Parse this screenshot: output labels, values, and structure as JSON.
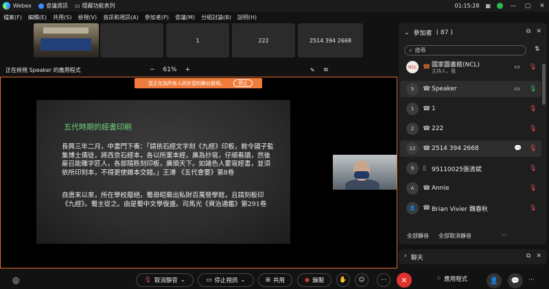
{
  "titlebar": {
    "app_name": "Webex",
    "meeting_info": "會議資訊",
    "hidden_features": "隱藏功能表列",
    "time": "01:15:28",
    "minimize": "—",
    "maximize": "▢",
    "close": "✕"
  },
  "menu": [
    "檔案(F)",
    "編輯(E)",
    "共用(S)",
    "檢視(V)",
    "音訊和視訊(A)",
    "參加者(P)",
    "會議(M)",
    "分組討論(B)",
    "說明(H)"
  ],
  "thumbnails": [
    {
      "label": ""
    },
    {
      "label": ""
    },
    {
      "label": "1"
    },
    {
      "label": "222"
    },
    {
      "label": "2514 394 2668"
    }
  ],
  "sharebar": {
    "viewing_text": "正在檢視 Speaker 的應用程式",
    "zoom_minus": "−",
    "zoom_level": "61%",
    "zoom_plus": "+"
  },
  "notice": {
    "text": "您正在為所有人同步您的舞台檢視。",
    "stop_label": "停止"
  },
  "slide": {
    "title": "五代時期的經書印刷",
    "para1": "長興三年二月，中書門下奏：「請依石經文字刻《九經》印板，敕令國子監集博士儒徒，將西京石經本，各以所業本經，廣為抄寫，仔細看讀，然後雇召能雕字匠人，各部隨秩刻印板，廣頒天下。如諸色人要寫經書，並須依所印刻本，不得更使雜本交錯。」王溥 《五代會要》第8卷",
    "para2": "自唐末以來，所在學校廢絕，蜀毋昭裔出私財百萬營學館，且請刻板印《九經》。蜀主從之。由是蜀中文學復盛。司馬光《資治通鑑》第291卷"
  },
  "toolbar": {
    "unmute": "取消靜音",
    "stop_video": "停止視訊",
    "share": "共用",
    "record": "錄製",
    "apps": "應用程式"
  },
  "participants": {
    "title": "參加者",
    "count": "( 87 )",
    "search_placeholder": "搜尋",
    "mute_all": "全部靜音",
    "unmute_all": "全部取消靜音",
    "list": [
      {
        "avatar": "NCL",
        "name": "國家圖書館(NCL)",
        "role": "主持人，我",
        "type": "☎",
        "video": "▭",
        "mic": "🎙"
      },
      {
        "avatar": "S",
        "name": "Speaker",
        "role": "",
        "type": "☎",
        "video": "▭",
        "mic": "🎙"
      },
      {
        "avatar": "1",
        "name": "1",
        "role": "",
        "type": "☎",
        "video": "",
        "mic": "🎙"
      },
      {
        "avatar": "2",
        "name": "222",
        "role": "",
        "type": "☎",
        "video": "",
        "mic": "🎙"
      },
      {
        "avatar": "22",
        "name": "2514 394 2668",
        "role": "",
        "type": "☎",
        "video": "💬",
        "mic": "🎙"
      },
      {
        "avatar": "9",
        "name": "95110025張清斌",
        "role": "",
        "type": "▯",
        "video": "",
        "mic": "🎙"
      },
      {
        "avatar": "A",
        "name": "Annie",
        "role": "",
        "type": "☎",
        "video": "",
        "mic": "🎙"
      },
      {
        "avatar": "👤",
        "name": "Brian Vivier 魏春秋",
        "role": "",
        "type": "☎",
        "video": "",
        "mic": "🎙"
      }
    ]
  },
  "chat": {
    "title": "聊天"
  },
  "colors": {
    "accent": "#f07c3c",
    "mute_red": "#e24b4b",
    "end_red": "#e0322f",
    "slide_title": "#6cd37a"
  }
}
